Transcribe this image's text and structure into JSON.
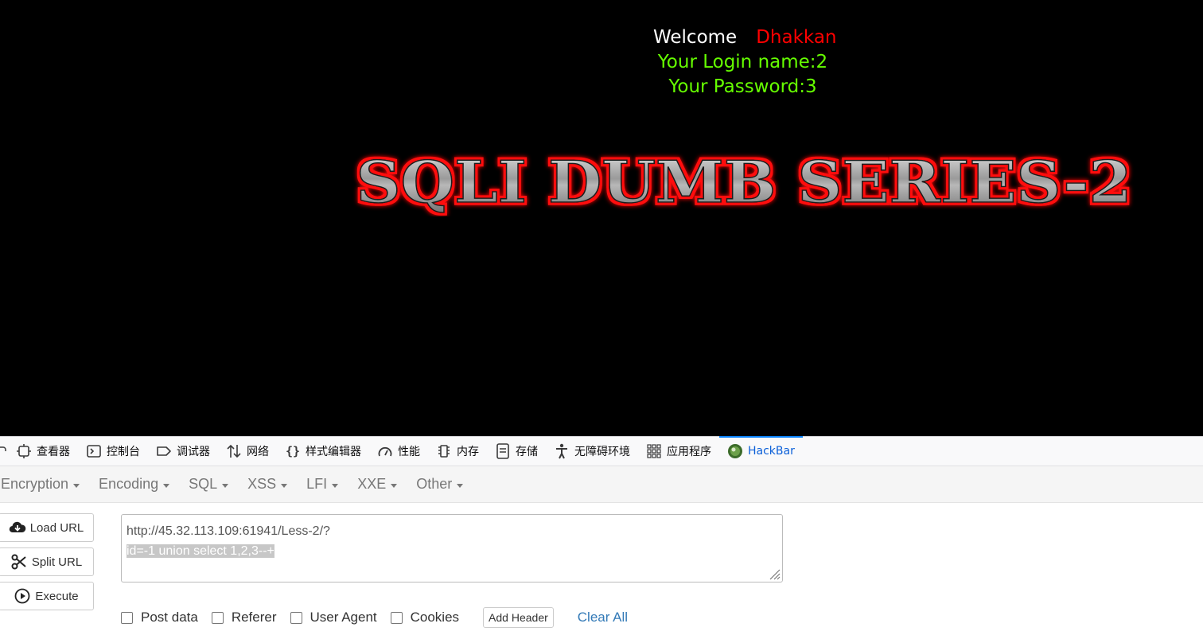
{
  "page": {
    "welcome_label": "Welcome",
    "user_name": "Dhakkan",
    "login_line": "Your Login name:2",
    "password_line": "Your Password:3",
    "banner_text": "SQLI DUMB SERIES-2"
  },
  "devtools": {
    "tabs": [
      {
        "label": "查看器",
        "icon": "inspector-icon"
      },
      {
        "label": "控制台",
        "icon": "console-icon"
      },
      {
        "label": "调试器",
        "icon": "debugger-icon"
      },
      {
        "label": "网络",
        "icon": "network-icon"
      },
      {
        "label": "样式编辑器",
        "icon": "style-editor-icon"
      },
      {
        "label": "性能",
        "icon": "performance-icon"
      },
      {
        "label": "内存",
        "icon": "memory-icon"
      },
      {
        "label": "存储",
        "icon": "storage-icon"
      },
      {
        "label": "无障碍环境",
        "icon": "accessibility-icon"
      },
      {
        "label": "应用程序",
        "icon": "application-icon"
      },
      {
        "label": "HackBar",
        "icon": "hackbar-icon",
        "active": true
      }
    ]
  },
  "hackbar": {
    "menu": [
      "Encryption",
      "Encoding",
      "SQL",
      "XSS",
      "LFI",
      "XXE",
      "Other"
    ],
    "buttons": {
      "load_url": "Load URL",
      "split_url": "Split URL",
      "execute": "Execute"
    },
    "url_line1": "http://45.32.113.109:61941/Less-2/?",
    "url_line2_selected": "id=-1 union select 1,2,3--+",
    "options": {
      "post_data": "Post data",
      "referer": "Referer",
      "user_agent": "User Agent",
      "cookies": "Cookies"
    },
    "add_header": "Add Header",
    "clear_all": "Clear All"
  },
  "colors": {
    "page_bg": "#000000",
    "welcome": "#ffffff",
    "user_name": "#ff0000",
    "credentials": "#66ff00",
    "active_tab": "#0a84ff",
    "link": "#337ab7"
  }
}
